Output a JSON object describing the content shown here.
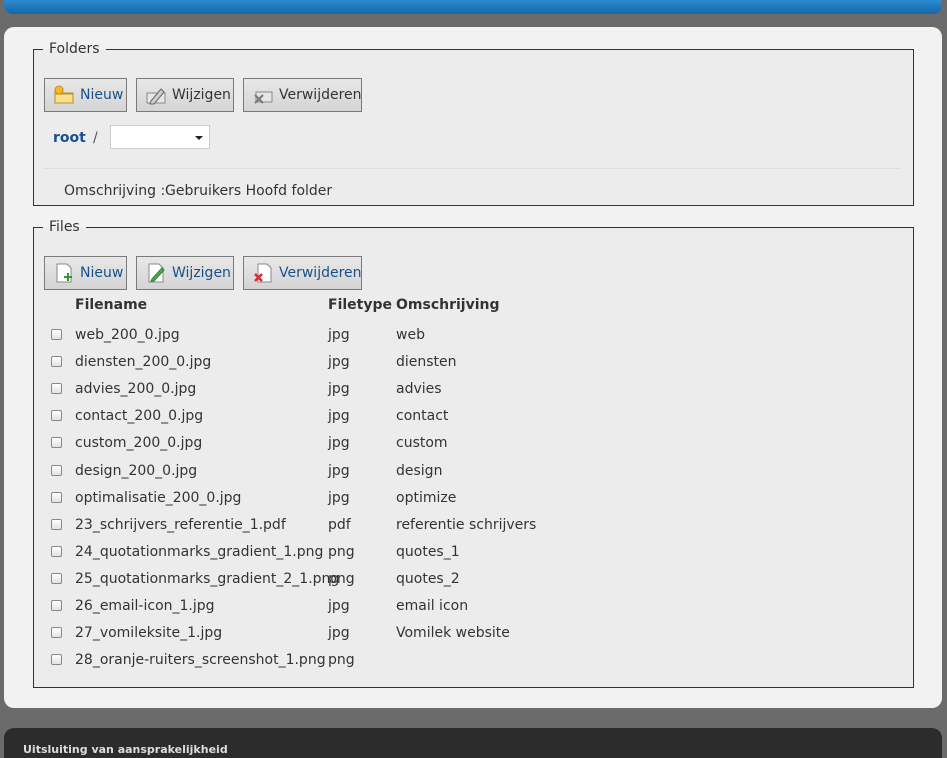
{
  "folders": {
    "legend": "Folders",
    "buttons": {
      "new_label": "Nieuw",
      "edit_label": "Wijzigen",
      "delete_label": "Verwijderen"
    },
    "breadcrumb": {
      "root_label": "root",
      "separator": "/"
    },
    "select": {
      "value": ""
    },
    "description": {
      "label": "Omschrijving :",
      "value": "Gebruikers Hoofd folder"
    }
  },
  "files": {
    "legend": "Files",
    "buttons": {
      "new_label": "Nieuw",
      "edit_label": "Wijzigen",
      "delete_label": "Verwijderen"
    },
    "columns": [
      "Filename",
      "Filetype",
      "Omschrijving"
    ],
    "rows": [
      {
        "filename": "web_200_0.jpg",
        "filetype": "jpg",
        "description": "web"
      },
      {
        "filename": "diensten_200_0.jpg",
        "filetype": "jpg",
        "description": "diensten"
      },
      {
        "filename": "advies_200_0.jpg",
        "filetype": "jpg",
        "description": "advies"
      },
      {
        "filename": "contact_200_0.jpg",
        "filetype": "jpg",
        "description": "contact"
      },
      {
        "filename": "custom_200_0.jpg",
        "filetype": "jpg",
        "description": "custom"
      },
      {
        "filename": "design_200_0.jpg",
        "filetype": "jpg",
        "description": "design"
      },
      {
        "filename": "optimalisatie_200_0.jpg",
        "filetype": "jpg",
        "description": "optimize"
      },
      {
        "filename": "23_schrijvers_referentie_1.pdf",
        "filetype": "pdf",
        "description": "referentie schrijvers"
      },
      {
        "filename": "24_quotationmarks_gradient_1.png",
        "filetype": "png",
        "description": "quotes_1"
      },
      {
        "filename": "25_quotationmarks_gradient_2_1.png",
        "filetype": "png",
        "description": "quotes_2"
      },
      {
        "filename": "26_email-icon_1.jpg",
        "filetype": "jpg",
        "description": "email icon"
      },
      {
        "filename": "27_vomileksite_1.jpg",
        "filetype": "jpg",
        "description": "Vomilek website"
      },
      {
        "filename": "28_oranje-ruiters_screenshot_1.png",
        "filetype": "png",
        "description": ""
      }
    ]
  },
  "footer": {
    "text": "Uitsluiting van aansprakelijkheid"
  },
  "colors": {
    "link": "#1a4f8a",
    "topbar": "#1f78be",
    "footer": "#2c2c2c"
  },
  "icons": {
    "folder_new": "folder-new-icon",
    "folder_edit": "folder-edit-icon",
    "folder_delete": "folder-delete-icon",
    "file_new": "file-new-icon",
    "file_edit": "file-edit-icon",
    "file_delete": "file-delete-icon",
    "select_arrow": "chevron-down-icon"
  }
}
